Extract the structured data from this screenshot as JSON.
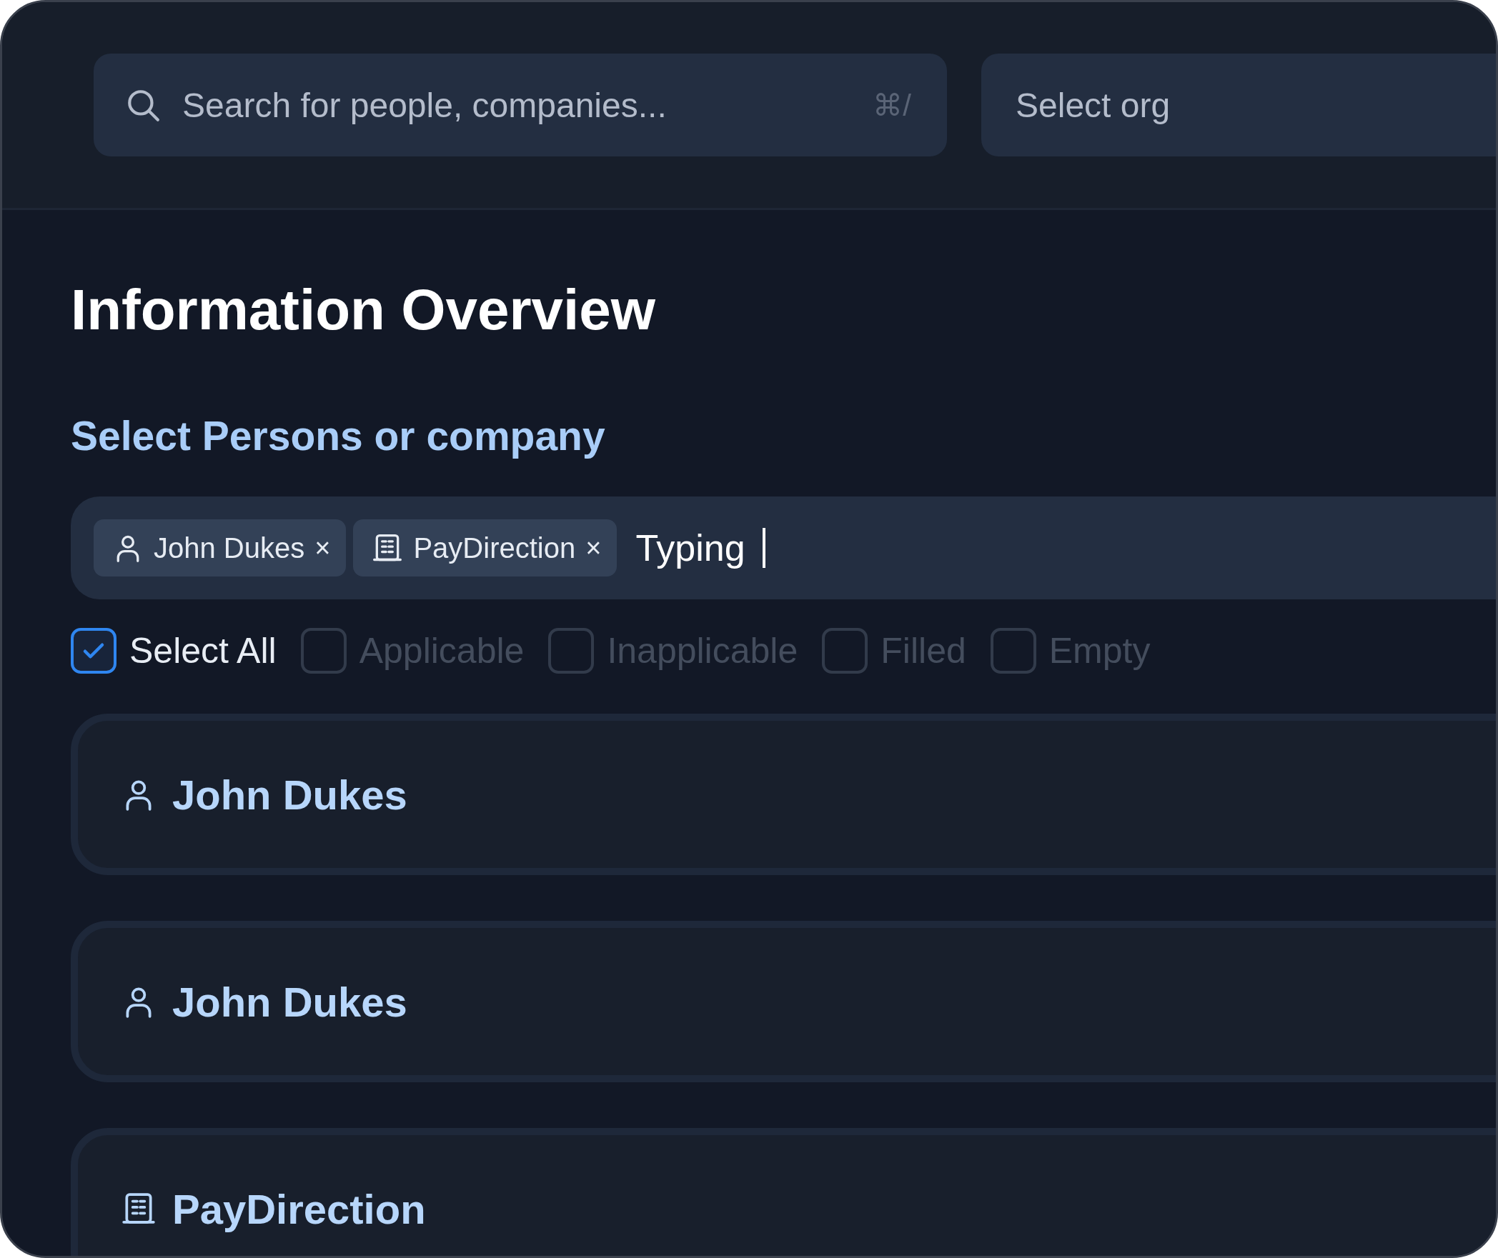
{
  "search": {
    "placeholder": "Search for people, companies...",
    "shortcut": "⌘/"
  },
  "org_select": {
    "placeholder": "Select org"
  },
  "title": "Information Overview",
  "section_title": "Select Persons or company",
  "selector": {
    "chips": [
      {
        "kind": "person",
        "label": "John Dukes",
        "remove": "×"
      },
      {
        "kind": "company",
        "label": "PayDirection",
        "remove": "×"
      }
    ],
    "value": "Typing "
  },
  "filters": [
    {
      "label": "Select All",
      "checked": true
    },
    {
      "label": "Applicable",
      "checked": false
    },
    {
      "label": "Inapplicable",
      "checked": false
    },
    {
      "label": "Filled",
      "checked": false
    },
    {
      "label": "Empty",
      "checked": false
    }
  ],
  "cards": [
    {
      "kind": "person",
      "name": "John Dukes"
    },
    {
      "kind": "person",
      "name": "John Dukes"
    },
    {
      "kind": "company",
      "name": "PayDirection"
    }
  ]
}
